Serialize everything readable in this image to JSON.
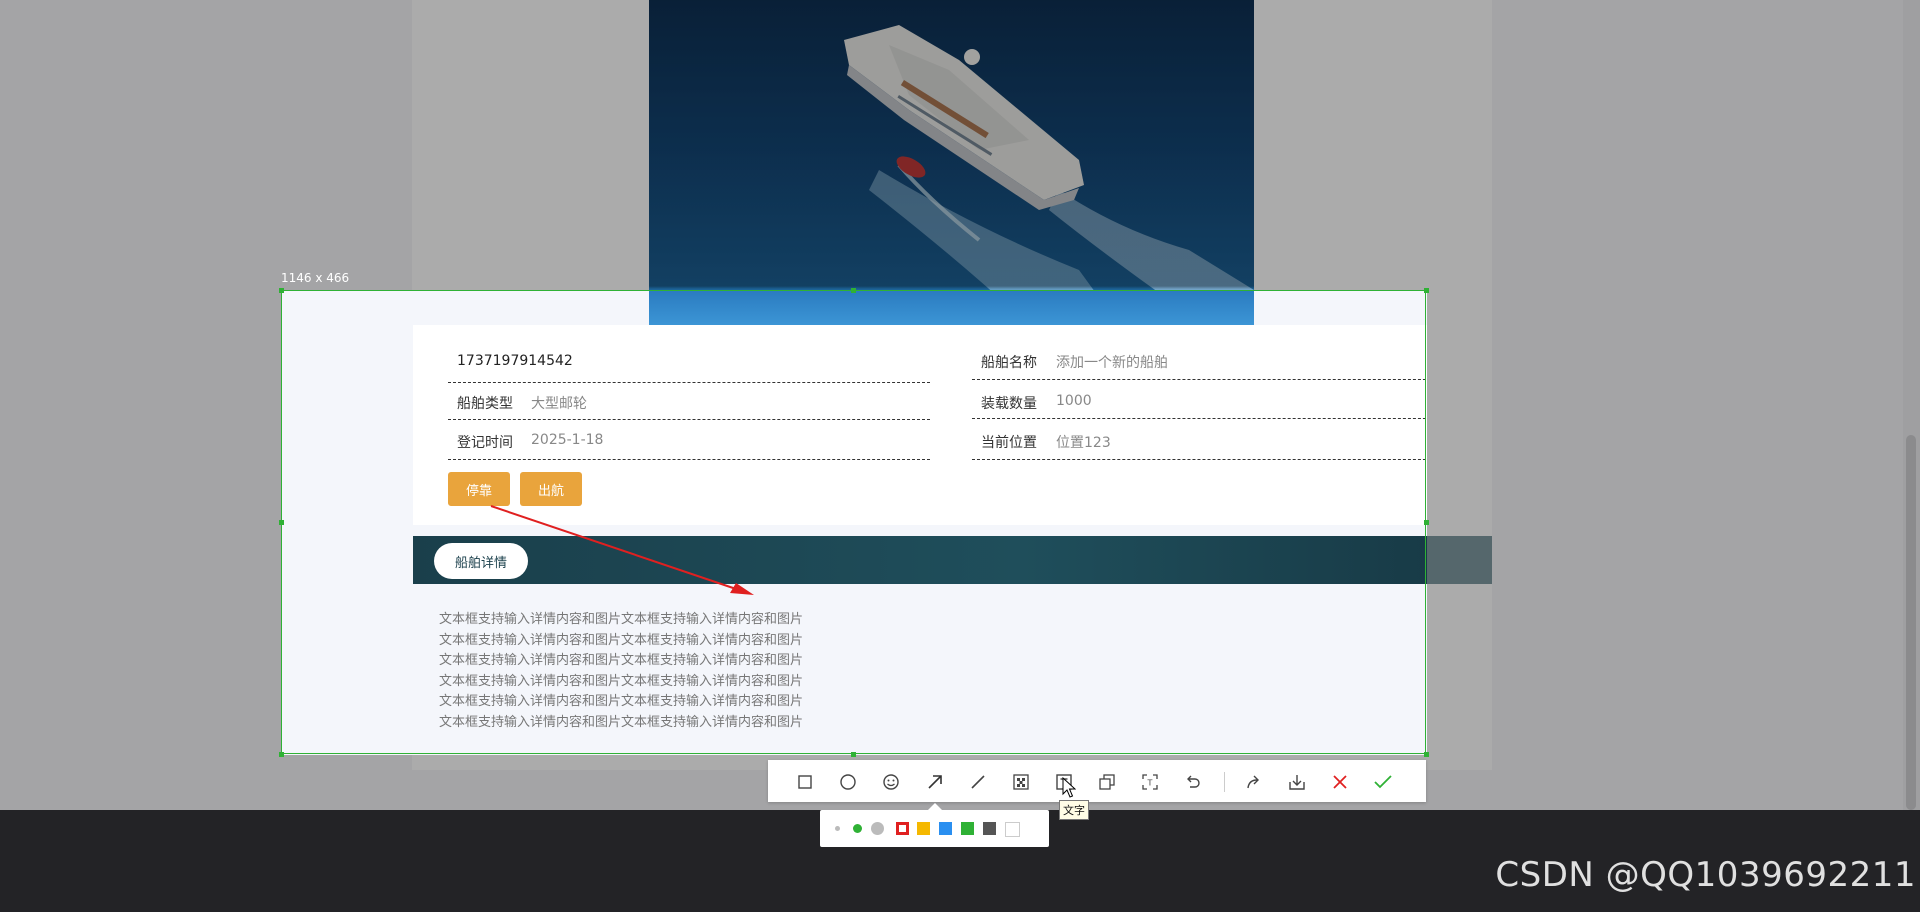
{
  "selection": {
    "size_label": "1146 x 466"
  },
  "ship_info": {
    "id": "1737197914542",
    "fields": [
      {
        "label": "船舶名称",
        "value": "添加一个新的船舶"
      },
      {
        "label": "船舶类型",
        "value": "大型邮轮"
      },
      {
        "label": "装载数量",
        "value": "1000"
      },
      {
        "label": "登记时间",
        "value": "2025-1-18"
      },
      {
        "label": "当前位置",
        "value": "位置123"
      }
    ],
    "buttons": {
      "dock": "停靠",
      "sail": "出航"
    }
  },
  "detail": {
    "tab_label": "船舶详情",
    "text": "文本框支持输入详情内容和图片文本框支持输入详情内容和图片\n文本框支持输入详情内容和图片文本框支持输入详情内容和图片\n文本框支持输入详情内容和图片文本框支持输入详情内容和图片\n文本框支持输入详情内容和图片文本框支持输入详情内容和图片\n文本框支持输入详情内容和图片文本框支持输入详情内容和图片\n文本框支持输入详情内容和图片文本框支持输入详情内容和图片"
  },
  "toolbar": {
    "tools": [
      {
        "icon": "rectangle-icon"
      },
      {
        "icon": "ellipse-icon"
      },
      {
        "icon": "emoji-icon"
      },
      {
        "icon": "arrow-icon"
      },
      {
        "icon": "line-icon"
      },
      {
        "icon": "mosaic-icon"
      },
      {
        "icon": "text-icon"
      },
      {
        "icon": "pin-icon"
      },
      {
        "icon": "ocr-icon"
      },
      {
        "icon": "undo-icon"
      },
      {
        "icon": "share-icon"
      },
      {
        "icon": "save-icon"
      },
      {
        "icon": "close-icon"
      },
      {
        "icon": "confirm-icon"
      }
    ],
    "tooltip": "文字"
  },
  "palette": {
    "colors": [
      "#e02020",
      "#f5b800",
      "#2a8ff0",
      "#2fb135",
      "#555555",
      "#ffffff"
    ],
    "selected_color": "#e02020"
  },
  "watermark": "CSDN @QQ1039692211",
  "annotation_arrow_color": "#e02020"
}
